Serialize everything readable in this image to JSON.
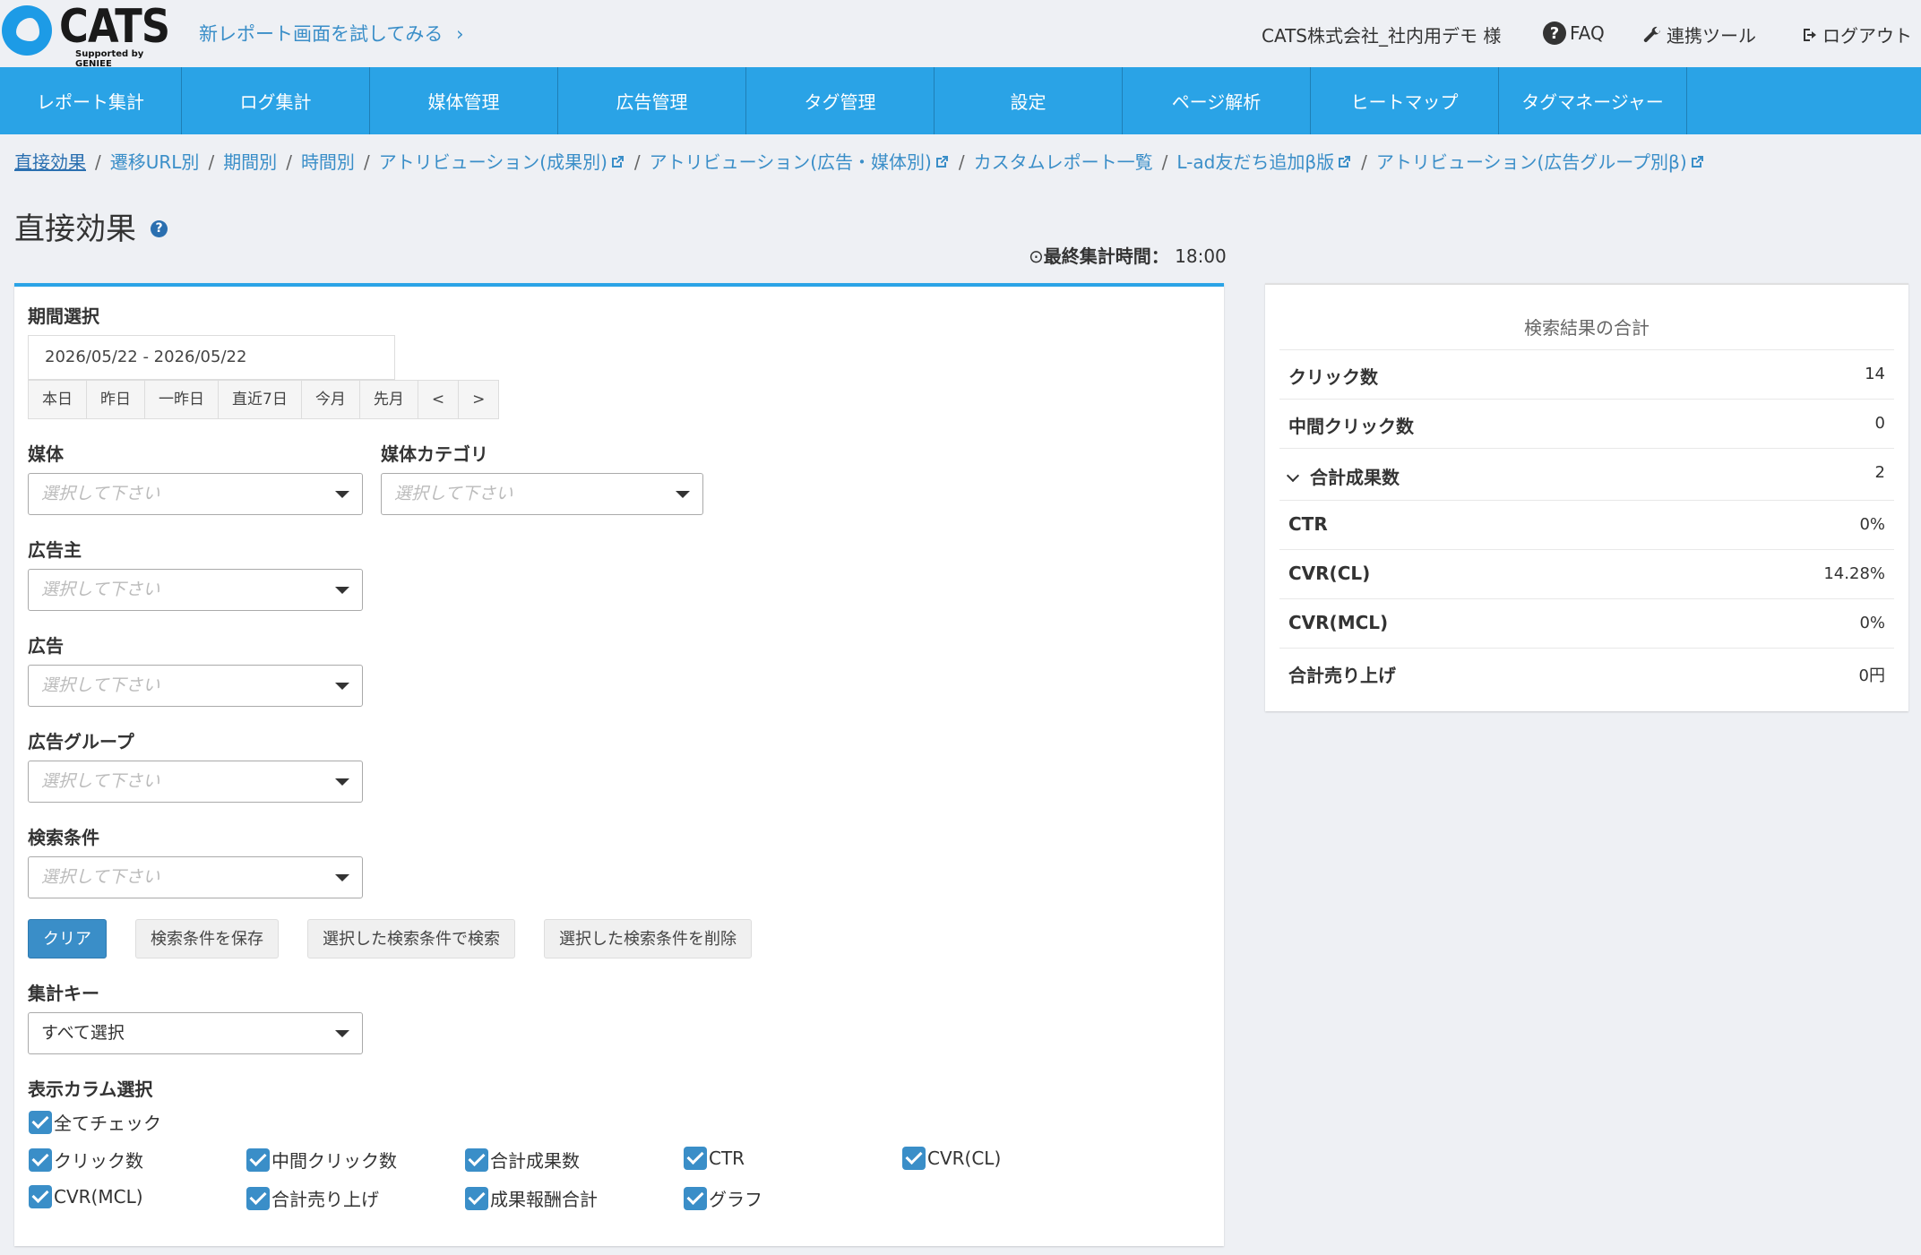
{
  "header": {
    "logo_text": "CATS",
    "logo_sub": "Supported by GENIEE",
    "try_new_report": "新レポート画面を試してみる",
    "user": "CATS株式会社_社内用デモ 様",
    "faq": "FAQ",
    "tools": "連携ツール",
    "logout": "ログアウト"
  },
  "nav": [
    "レポート集計",
    "ログ集計",
    "媒体管理",
    "広告管理",
    "タグ管理",
    "設定",
    "ページ解析",
    "ヒートマップ",
    "タグマネージャー"
  ],
  "breadcrumb": {
    "active": "直接効果",
    "items": [
      "遷移URL別",
      "期間別",
      "時間別",
      "アトリビューション(成果別)",
      "アトリビューション(広告・媒体別)",
      "カスタムレポート一覧",
      "L-ad友だち追加β版",
      "アトリビューション(広告グループ別β)"
    ]
  },
  "page": {
    "title": "直接効果",
    "last_time_label": "最終集計時間：",
    "last_time": "18:00"
  },
  "form": {
    "period_label": "期間選択",
    "period_value": "2026/05/22 - 2026/05/22",
    "period_buttons": [
      "本日",
      "昨日",
      "一昨日",
      "直近7日",
      "今月",
      "先月",
      "<",
      ">"
    ],
    "media_label": "媒体",
    "media_category_label": "媒体カテゴリ",
    "advertiser_label": "広告主",
    "ad_label": "広告",
    "ad_group_label": "広告グループ",
    "search_cond_label": "検索条件",
    "placeholder": "選択して下さい",
    "btn_clear": "クリア",
    "btn_save": "検索条件を保存",
    "btn_search_selected": "選択した検索条件で検索",
    "btn_delete_selected": "選択した検索条件を削除",
    "agg_key_label": "集計キー",
    "agg_key_value": "すべて選択",
    "columns_label": "表示カラム選択",
    "check_all": "全てチェック",
    "columns": [
      "クリック数",
      "中間クリック数",
      "合計成果数",
      "CTR",
      "CVR(CL)",
      "CVR(MCL)",
      "合計売り上げ",
      "成果報酬合計",
      "グラフ"
    ]
  },
  "summary": {
    "title": "検索結果の合計",
    "rows": [
      {
        "label": "クリック数",
        "value": "14"
      },
      {
        "label": "中間クリック数",
        "value": "0"
      },
      {
        "label": "合計成果数",
        "value": "2"
      },
      {
        "label": "CTR",
        "value": "0%"
      },
      {
        "label": "CVR(CL)",
        "value": "14.28%"
      },
      {
        "label": "CVR(MCL)",
        "value": "0%"
      },
      {
        "label": "合計売り上げ",
        "value": "0円"
      }
    ]
  }
}
